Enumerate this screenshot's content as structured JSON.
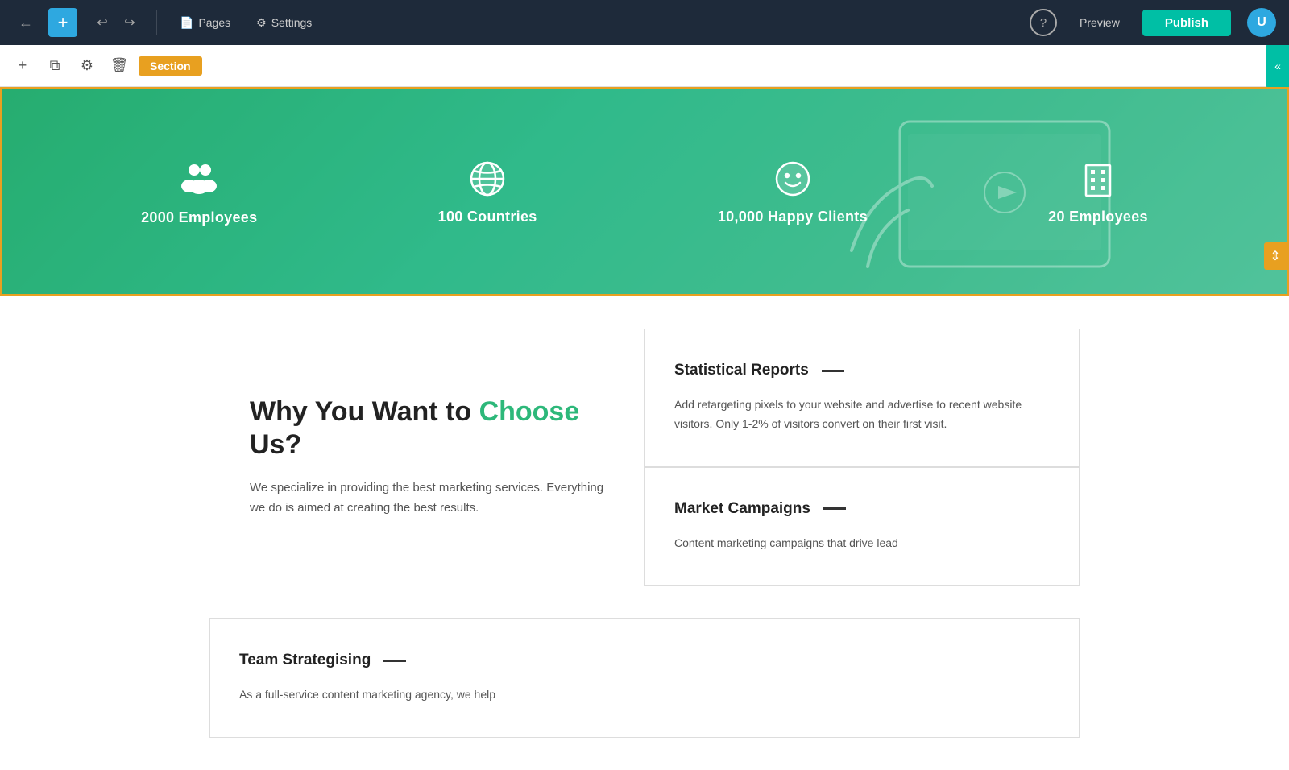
{
  "topNav": {
    "backLabel": "‹",
    "addLabel": "+",
    "undoLabel": "↩",
    "redoLabel": "↪",
    "pagesLabel": "Pages",
    "settingsLabel": "Settings",
    "helpLabel": "?",
    "previewLabel": "Preview",
    "publishLabel": "Publish",
    "avatarLabel": "U",
    "pagesIcon": "📄",
    "settingsIcon": "⚙"
  },
  "sectionToolbar": {
    "addIcon": "+",
    "duplicateIcon": "⧉",
    "settingsIcon": "⚙",
    "deleteIcon": "🗑",
    "sectionLabel": "Section",
    "collapseIcon": "«"
  },
  "hero": {
    "stats": [
      {
        "icon": "👥",
        "label": "2000 Employees"
      },
      {
        "icon": "🌐",
        "label": "100 Countries"
      },
      {
        "icon": "😊",
        "label": "10,000 Happy Clients"
      },
      {
        "icon": "🏢",
        "label": "20 Employees"
      }
    ]
  },
  "cards": [
    {
      "title": "Statistical Reports",
      "dash": "—",
      "text": "Add retargeting pixels to your website and advertise to recent website visitors. Only 1-2% of visitors convert on their first visit."
    },
    {
      "title": "Market Campaigns",
      "dash": "—",
      "text": "Content marketing campaigns that drive lead"
    },
    {
      "title": "Team Strategising",
      "dash": "—",
      "text": "As a full-service content marketing agency, we help"
    }
  ],
  "rightPanel": {
    "titleStart": "Why You Want to ",
    "titleHighlight": "Choose",
    "titleEnd": " Us?",
    "text": "We specialize in providing the best marketing services. Everything we do is aimed at creating the best results."
  },
  "arrowBtn": "⇕"
}
